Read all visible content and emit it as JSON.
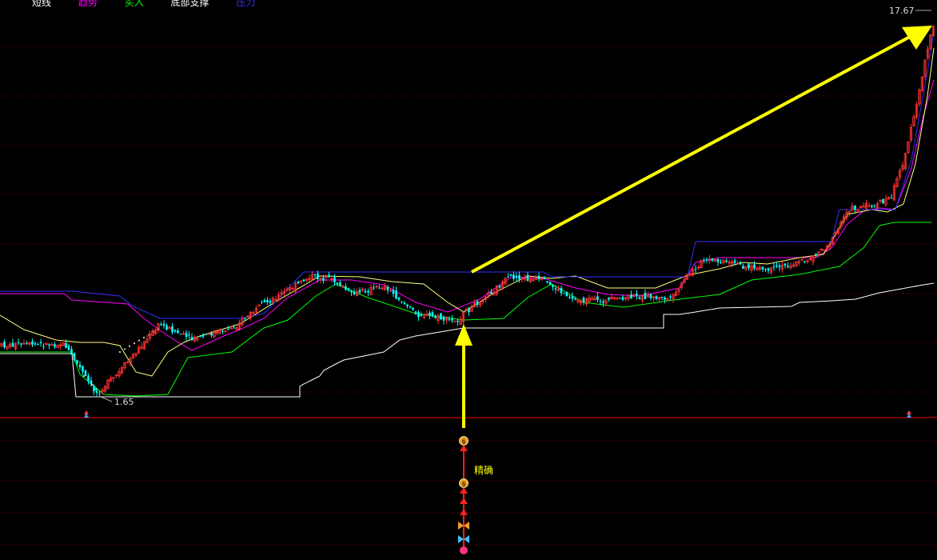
{
  "chart_data": {
    "type": "candlestick",
    "price_labels": {
      "high": "17.67",
      "low": "1.65"
    },
    "annotation": {
      "text": "精确",
      "color": "#ffff00"
    },
    "legend": [
      {
        "name": "短线",
        "color": "#ffffff"
      },
      {
        "name": "趋势",
        "color": "#ff00ff"
      },
      {
        "name": "买入",
        "color": "#00ff00"
      },
      {
        "name": "底部支撑",
        "color": "#ffffff"
      },
      {
        "name": "压力",
        "color": "#0000ff"
      }
    ],
    "colors": {
      "up": "#ff3232",
      "down": "#00ffff",
      "grid": "#8b0000",
      "divider": "#c00000",
      "arrow": "#ffff00",
      "trend": "#ff00ff",
      "buy": "#00ff00",
      "short": "#ffff7f",
      "support": "#ffffff",
      "pressure": "#3030ff"
    }
  }
}
